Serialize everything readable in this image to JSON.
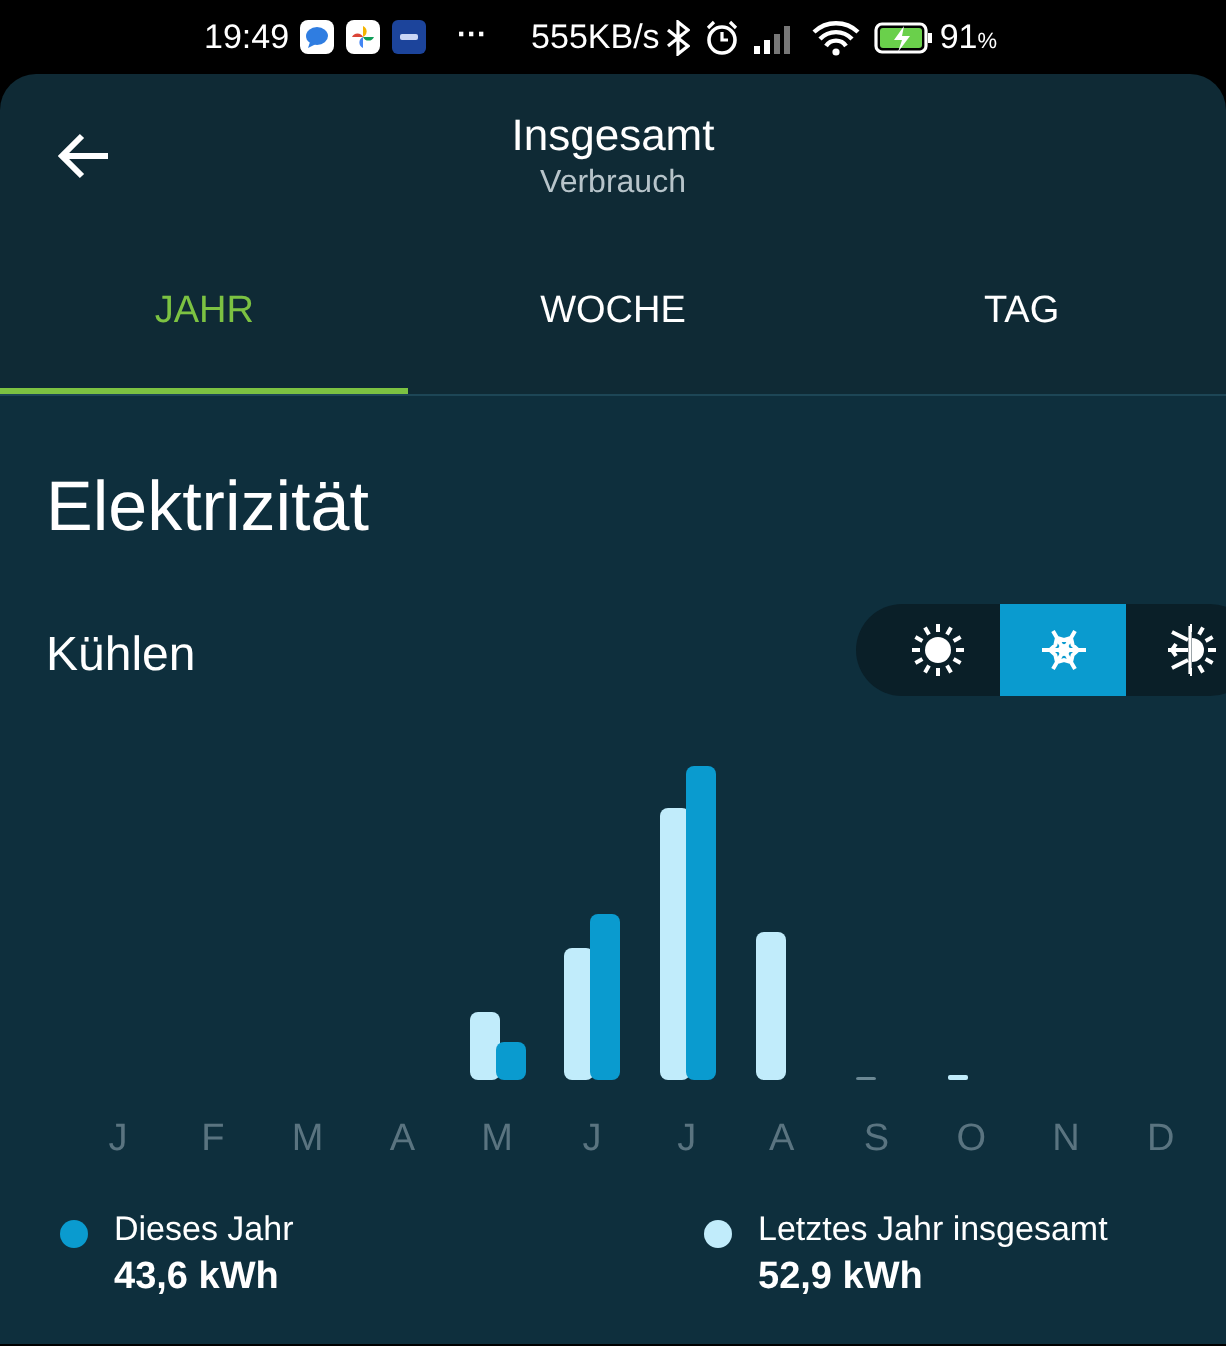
{
  "status_bar": {
    "time": "19:49",
    "notification_icons": [
      {
        "kind": "chat"
      },
      {
        "kind": "pinwheel"
      },
      {
        "kind": "mail"
      }
    ],
    "more": "···",
    "speed": "555KB/s",
    "battery": "91",
    "battery_unit": "%"
  },
  "header": {
    "title": "Insgesamt",
    "subtitle": "Verbrauch"
  },
  "tabs": [
    {
      "label": "JAHR",
      "selected": true
    },
    {
      "label": "WOCHE",
      "selected": false
    },
    {
      "label": "TAG",
      "selected": false
    }
  ],
  "section_title": "Elektrizität",
  "mode_label": "Kühlen",
  "modes": [
    {
      "kind": "heat",
      "selected": false
    },
    {
      "kind": "cool",
      "selected": true
    },
    {
      "kind": "both",
      "selected": false
    }
  ],
  "months": [
    "J",
    "F",
    "M",
    "A",
    "M",
    "J",
    "J",
    "A",
    "S",
    "O",
    "N",
    "D"
  ],
  "legend": [
    {
      "label": "Dieses Jahr",
      "value": "43,6 kWh",
      "color": "#0a9bcf"
    },
    {
      "label": "Letztes Jahr insgesamt",
      "value": "52,9 kWh",
      "color": "#c1ecfb"
    }
  ]
}
